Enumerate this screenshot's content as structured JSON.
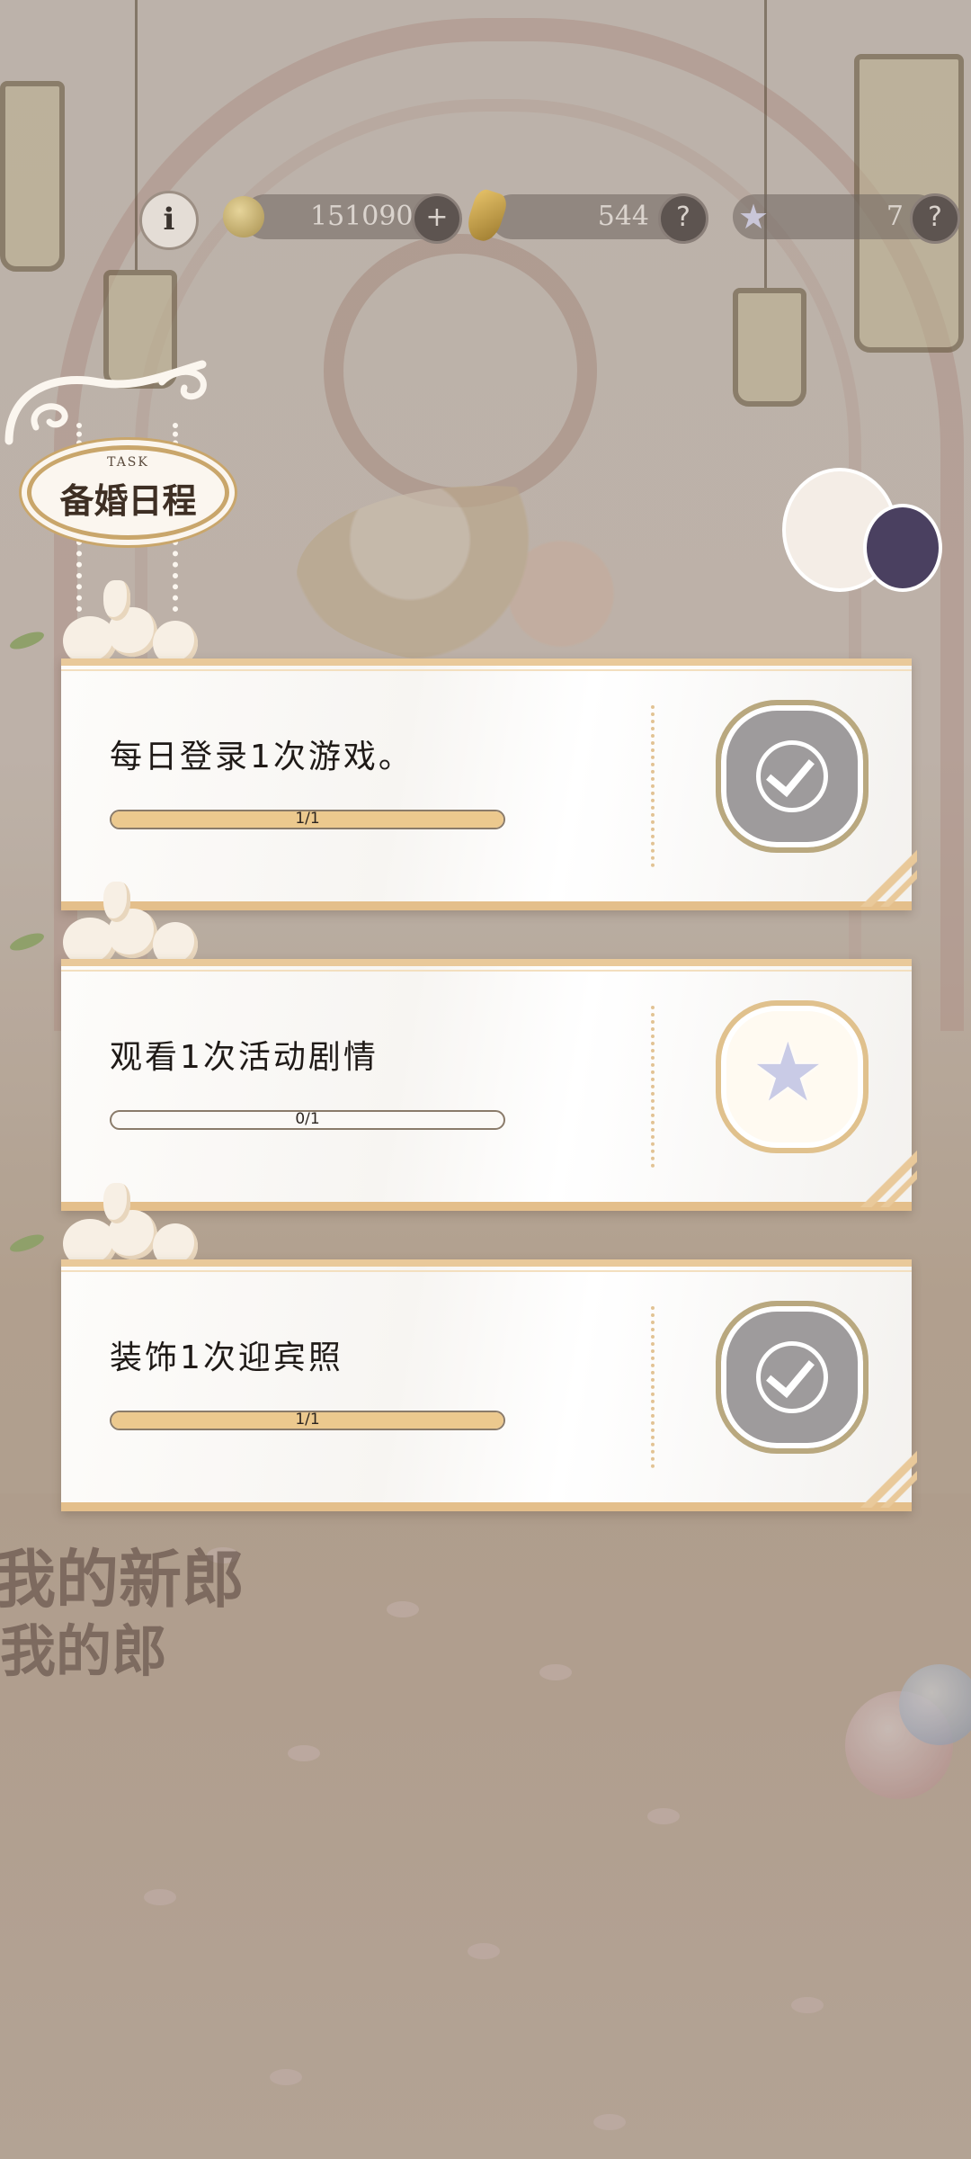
{
  "header": {
    "info_icon": "info-icon",
    "gold": {
      "icon": "gold-coin-icon",
      "value": "151090",
      "action_icon": "plus-icon",
      "action_label": "+"
    },
    "crystal": {
      "icon": "crystal-icon",
      "value": "544",
      "action_icon": "question-icon",
      "action_label": "?"
    },
    "star": {
      "icon": "star-icon",
      "value": "7",
      "action_icon": "question-icon",
      "action_label": "?"
    }
  },
  "panel": {
    "subtitle": "TASK",
    "title": "备婚日程"
  },
  "tasks": [
    {
      "title": "每日登录1次游戏。",
      "progress_text": "1/1",
      "progress": 1.0,
      "reward_state": "claimed",
      "reward_icon": "check-icon"
    },
    {
      "title": "观看1次活动剧情",
      "progress_text": "0/1",
      "progress": 0.0,
      "reward_state": "unclaimed",
      "reward_icon": "star-crystal-icon"
    },
    {
      "title": "装饰1次迎宾照",
      "progress_text": "1/1",
      "progress": 1.0,
      "reward_state": "claimed",
      "reward_icon": "check-icon"
    }
  ],
  "background_sign": {
    "line1": "我的新郎",
    "line2": "我的郎"
  },
  "colors": {
    "card_border": "#e4bf8b",
    "progress_fill": "#ecc98e",
    "claimed_badge": "#9e9b9c"
  }
}
